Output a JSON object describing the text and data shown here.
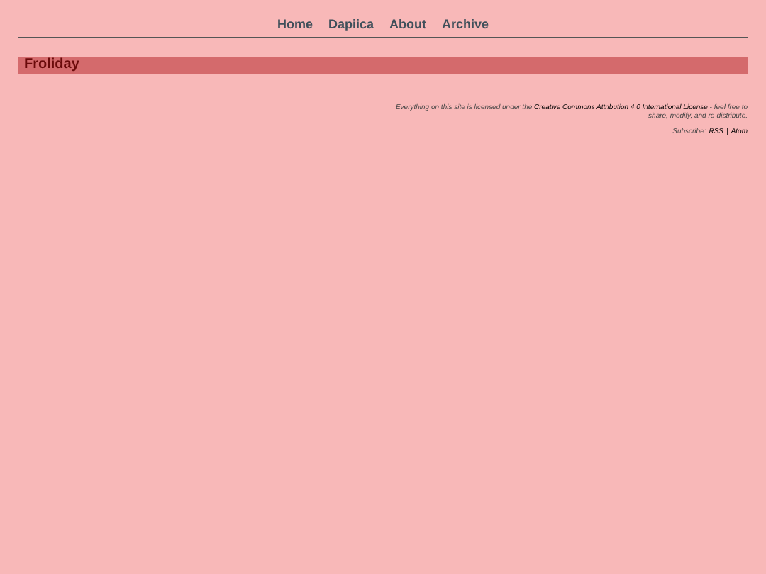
{
  "nav": [
    {
      "label": "Home"
    },
    {
      "label": "Dapiica"
    },
    {
      "label": "About"
    },
    {
      "label": "Archive"
    }
  ],
  "post_title": "Froliday",
  "license": {
    "before": "Everything on this site is licensed under the",
    "link": "Creative Commons Attribution 4.0 International License",
    "after": "- feel free to share, modify, and re-distribute."
  },
  "subscribe": {
    "label": "Subscribe:",
    "links": [
      "RSS",
      "Atom"
    ],
    "separator": "|"
  }
}
